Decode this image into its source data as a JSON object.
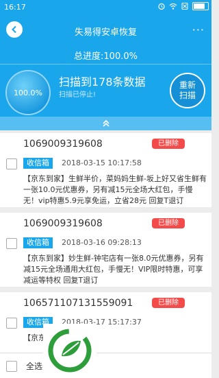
{
  "status_bar": {
    "time": "16:17"
  },
  "nav": {
    "title": "失易得安卓恢复",
    "more": "···"
  },
  "progress": {
    "total_label": "总进度:100.0%",
    "percent": "100.0%",
    "found_text": "扫描到178条数据",
    "stopped_text": "扫描已停止!",
    "rescan_label": "重新扫描"
  },
  "messages": [
    {
      "sender": "1069009319608",
      "badge": "已删除",
      "folder": "收信箱",
      "date": "2018-03-15 10:17:58",
      "content": "【京东到家】生鲜半价，菜妈妈生鲜-坂上好又省生鲜有一张10.0元优惠券，另有减15元全场大红包，手慢无！vip特惠5.9元享免运，立省28元 回复T退订"
    },
    {
      "sender": "1069009319608",
      "badge": "已删除",
      "folder": "收信箱",
      "date": "2018-03-16 09:28:13",
      "content": "【京东到家】妙生鲜-钟宅店有一张8.0元优惠券，另有减15元全场通用大红包，手慢无！VIP限时特惠，可享减运等特权 回复T退订"
    },
    {
      "sender": "106571107131559091",
      "badge": "已删除",
      "folder": "收信箱",
      "date": "2018-03-17 15:17:37",
      "content": "【京东"
    }
  ],
  "bottom": {
    "select_all": "全选"
  },
  "colors": {
    "primary": "#1aa6ea",
    "deleted_badge": "#f34a4a",
    "logo_green": "#2e9e3b"
  }
}
